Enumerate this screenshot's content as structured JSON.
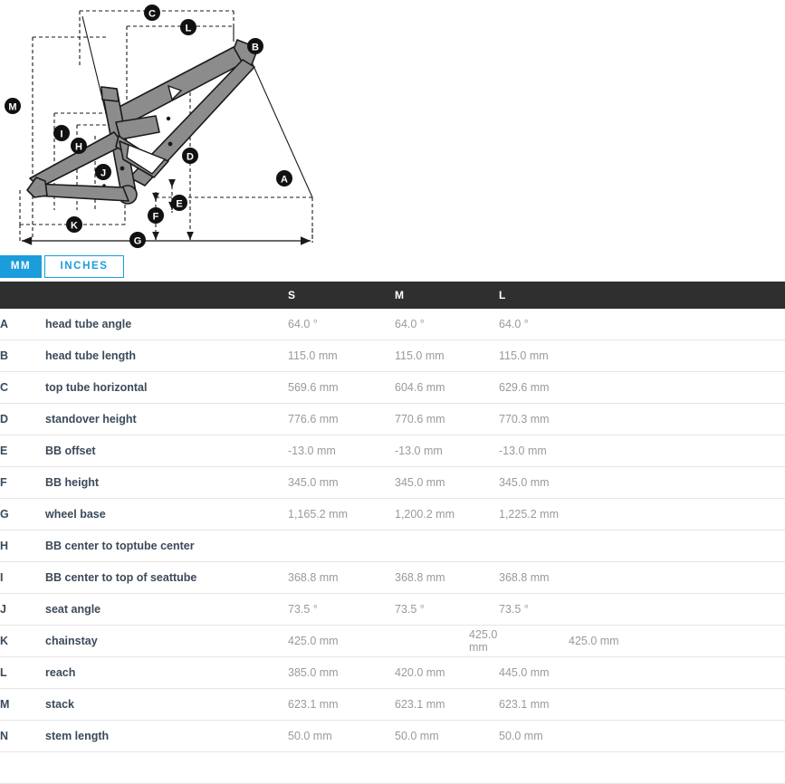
{
  "diagram": {
    "alt": "bicycle frame geometry diagram",
    "markers": [
      "A",
      "B",
      "C",
      "D",
      "E",
      "F",
      "G",
      "H",
      "I",
      "J",
      "K",
      "L",
      "M"
    ]
  },
  "unit_toggle": {
    "options": [
      {
        "label": "MM",
        "active": true
      },
      {
        "label": "INCHES",
        "active": false
      }
    ]
  },
  "table": {
    "headers": [
      "",
      "",
      "S",
      "M",
      "L"
    ],
    "rows": [
      {
        "letter": "A",
        "name": "head tube angle",
        "s": "64.0 °",
        "m": "64.0 °",
        "l": "64.0 °"
      },
      {
        "letter": "B",
        "name": "head tube length",
        "s": "115.0 mm",
        "m": "115.0 mm",
        "l": "115.0 mm"
      },
      {
        "letter": "C",
        "name": "top tube horizontal",
        "s": "569.6 mm",
        "m": "604.6 mm",
        "l": "629.6 mm"
      },
      {
        "letter": "D",
        "name": "standover height",
        "s": "776.6 mm",
        "m": "770.6 mm",
        "l": "770.3 mm"
      },
      {
        "letter": "E",
        "name": "BB offset",
        "s": "-13.0 mm",
        "m": "-13.0 mm",
        "l": "-13.0 mm"
      },
      {
        "letter": "F",
        "name": "BB height",
        "s": "345.0 mm",
        "m": "345.0 mm",
        "l": "345.0 mm"
      },
      {
        "letter": "G",
        "name": "wheel base",
        "s": "1,165.2 mm",
        "m": "1,200.2 mm",
        "l": "1,225.2 mm"
      },
      {
        "letter": "H",
        "name": "BB center to toptube center",
        "s": "",
        "m": "",
        "l": ""
      },
      {
        "letter": "I",
        "name": "BB center to top of seattube",
        "s": "368.8 mm",
        "m": "368.8 mm",
        "l": "368.8 mm"
      },
      {
        "letter": "J",
        "name": "seat angle",
        "s": "73.5 °",
        "m": "73.5 °",
        "l": "73.5 °"
      },
      {
        "letter": "K",
        "name": "chainstay",
        "s": "425.0 mm",
        "m": "425.0 mm",
        "l": "425.0 mm",
        "shifted": true
      },
      {
        "letter": "L",
        "name": "reach",
        "s": "385.0 mm",
        "m": "420.0 mm",
        "l": "445.0 mm"
      },
      {
        "letter": "M",
        "name": "stack",
        "s": "623.1 mm",
        "m": "623.1 mm",
        "l": "623.1 mm"
      },
      {
        "letter": "N",
        "name": "stem length",
        "s": "50.0 mm",
        "m": "50.0 mm",
        "l": "50.0 mm"
      },
      {
        "letter": "",
        "name": "",
        "s": "",
        "m": "",
        "l": ""
      }
    ]
  },
  "colors": {
    "accent": "#1b9ddb",
    "header_bar": "#2f2f2f",
    "frame_fill": "#8c8c8c",
    "frame_stroke": "#1a1a1a",
    "row_label": "#3b4a5a",
    "value_text": "#9a9a9a",
    "row_border": "#e6e6e6"
  }
}
